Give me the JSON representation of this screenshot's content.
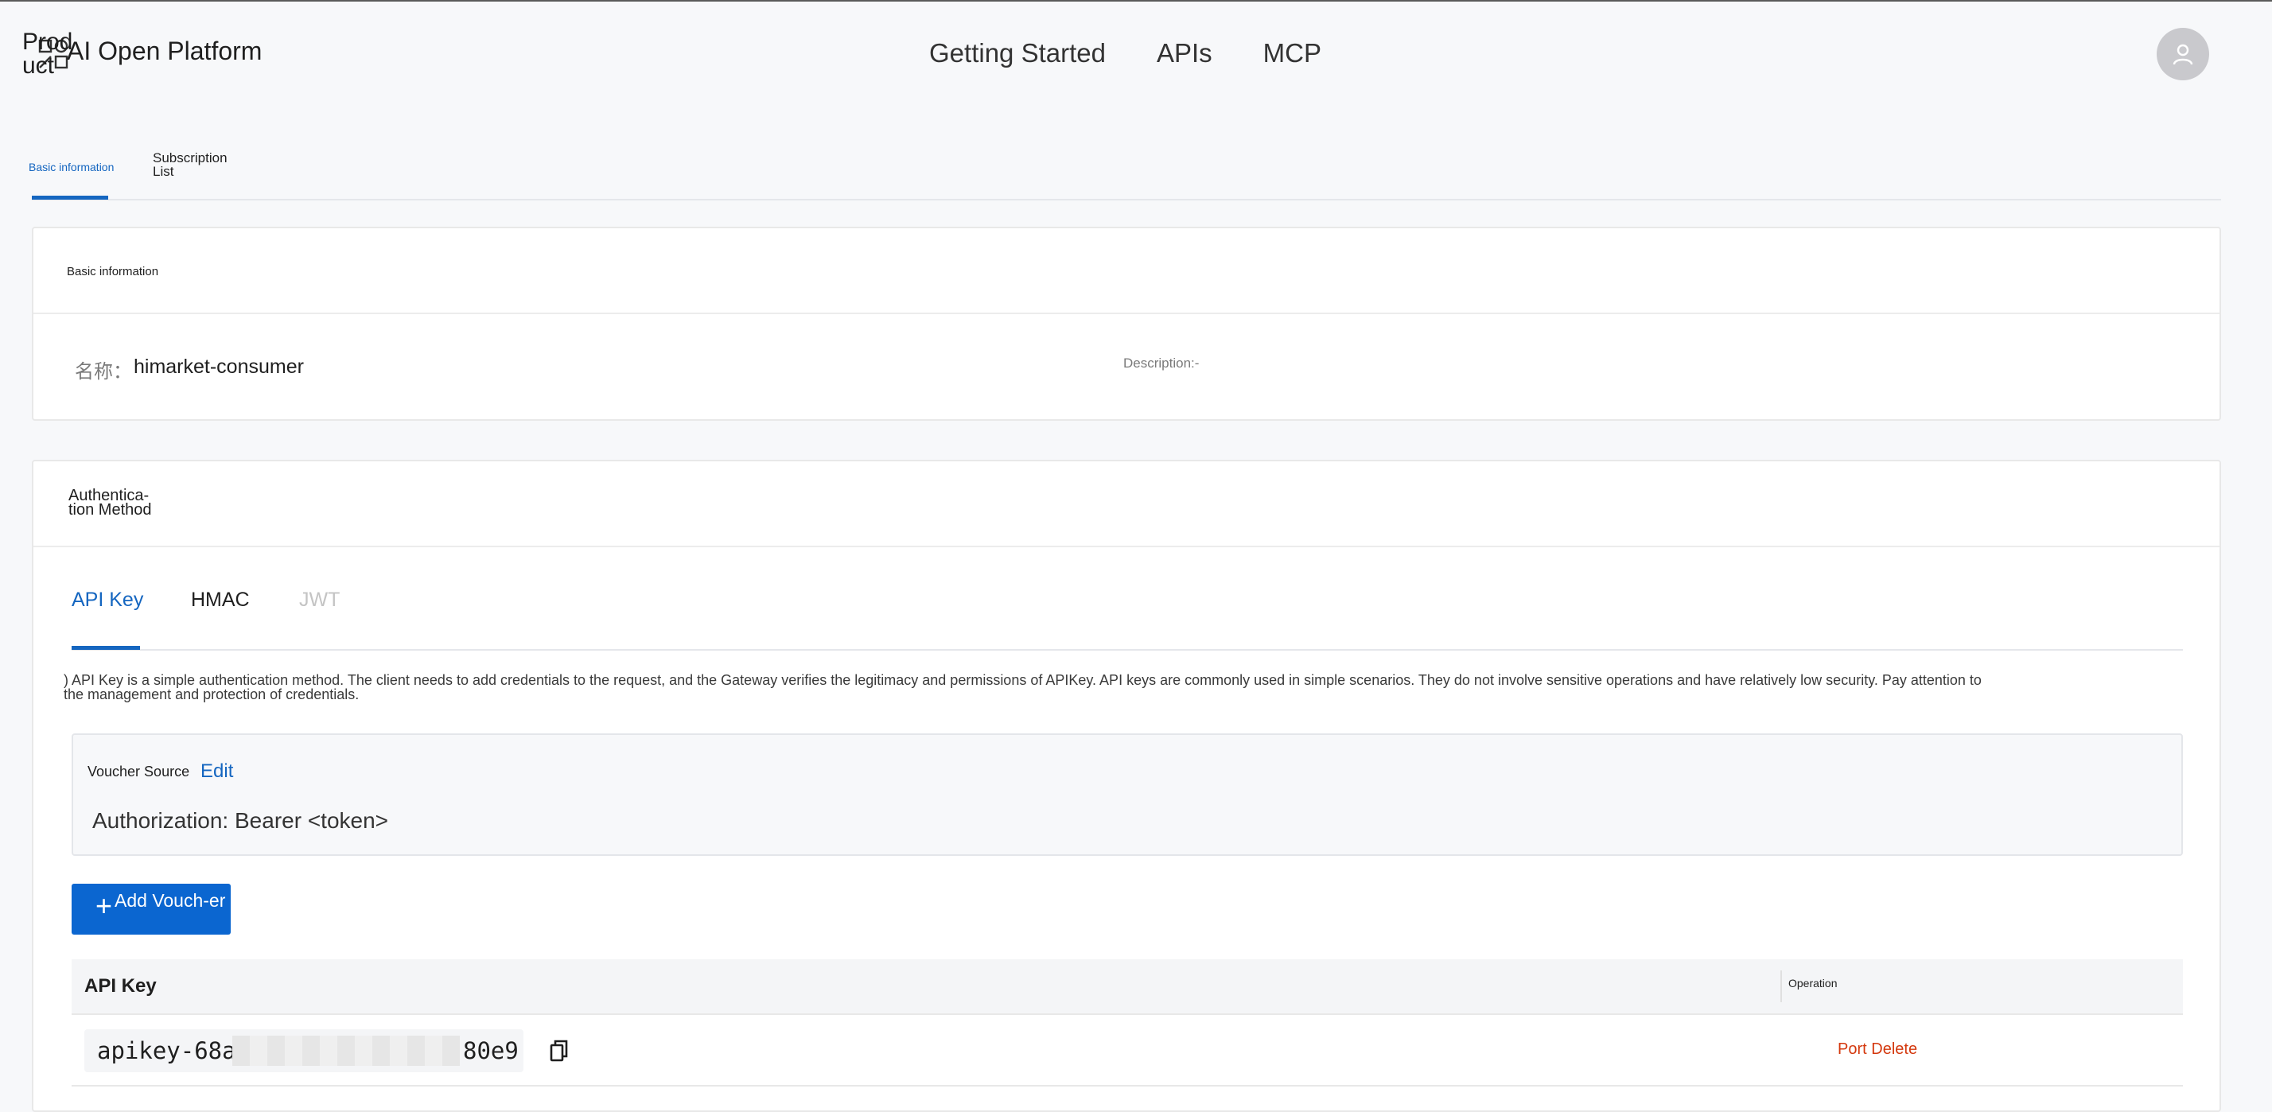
{
  "header": {
    "logo_alt": "Product",
    "title": "AI Open Platform",
    "nav": [
      "Getting Started",
      "APIs",
      "MCP"
    ]
  },
  "page_tabs": {
    "basic": "Basic information",
    "subscription": "Subscription List"
  },
  "basic_card": {
    "title": "Basic information",
    "name_label": "名称：",
    "name_value": "himarket-consumer",
    "description": "Description:-"
  },
  "auth_card": {
    "title": "Authentica-tion Method",
    "tabs": [
      "API Key",
      "HMAC",
      "JWT"
    ],
    "description": ") API Key is a simple authentication method. The client needs to add credentials to the request, and the Gateway verifies the legitimacy and permissions of APIKey. API keys are commonly used in simple scenarios. They do not involve sensitive operations and have relatively low security. Pay attention to the management and protection of credentials.",
    "voucher": {
      "label": "Voucher Source",
      "edit": "Edit",
      "value": "Authorization: Bearer <token>"
    },
    "add_button": "Add Vouch-er",
    "table": {
      "col_key": "API Key",
      "col_op": "Operation",
      "rows": [
        {
          "key_prefix": "apikey-68a",
          "key_suffix": "80e9",
          "op_port": "Port",
          "op_delete": "Delete"
        }
      ]
    }
  },
  "colors": {
    "accent": "#1566c0",
    "button": "#0b66d0",
    "danger": "#d4380d",
    "disabled": "#c4c4c4"
  }
}
